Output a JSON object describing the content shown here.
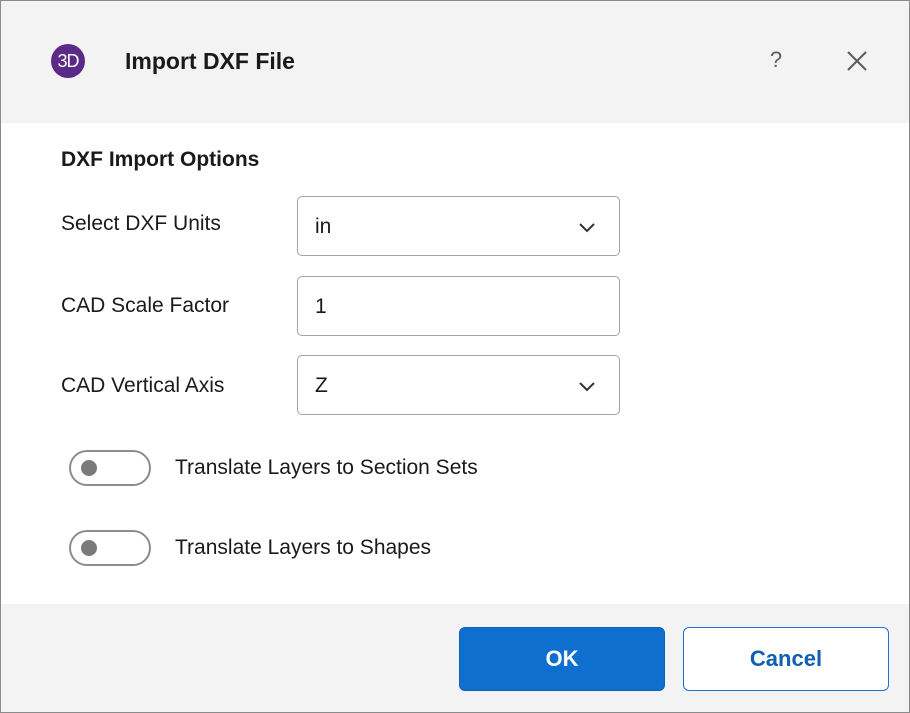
{
  "dialog": {
    "title": "Import DXF File",
    "logo_text": "3D",
    "help_label": "?",
    "accent_color": "#0f6fce",
    "logo_color": "#5b2a86"
  },
  "options": {
    "heading": "DXF Import Options",
    "units": {
      "label": "Select DXF Units",
      "value": "in"
    },
    "scale": {
      "label": "CAD Scale Factor",
      "value": "1"
    },
    "axis": {
      "label": "CAD Vertical Axis",
      "value": "Z"
    }
  },
  "toggles": [
    {
      "label": "Translate Layers to Section Sets",
      "on": false
    },
    {
      "label": "Translate Layers to Shapes",
      "on": false
    }
  ],
  "buttons": {
    "ok": "OK",
    "cancel": "Cancel"
  },
  "icons": {
    "close": "close-icon",
    "chevron": "chevron-down-icon",
    "help": "help-icon"
  }
}
